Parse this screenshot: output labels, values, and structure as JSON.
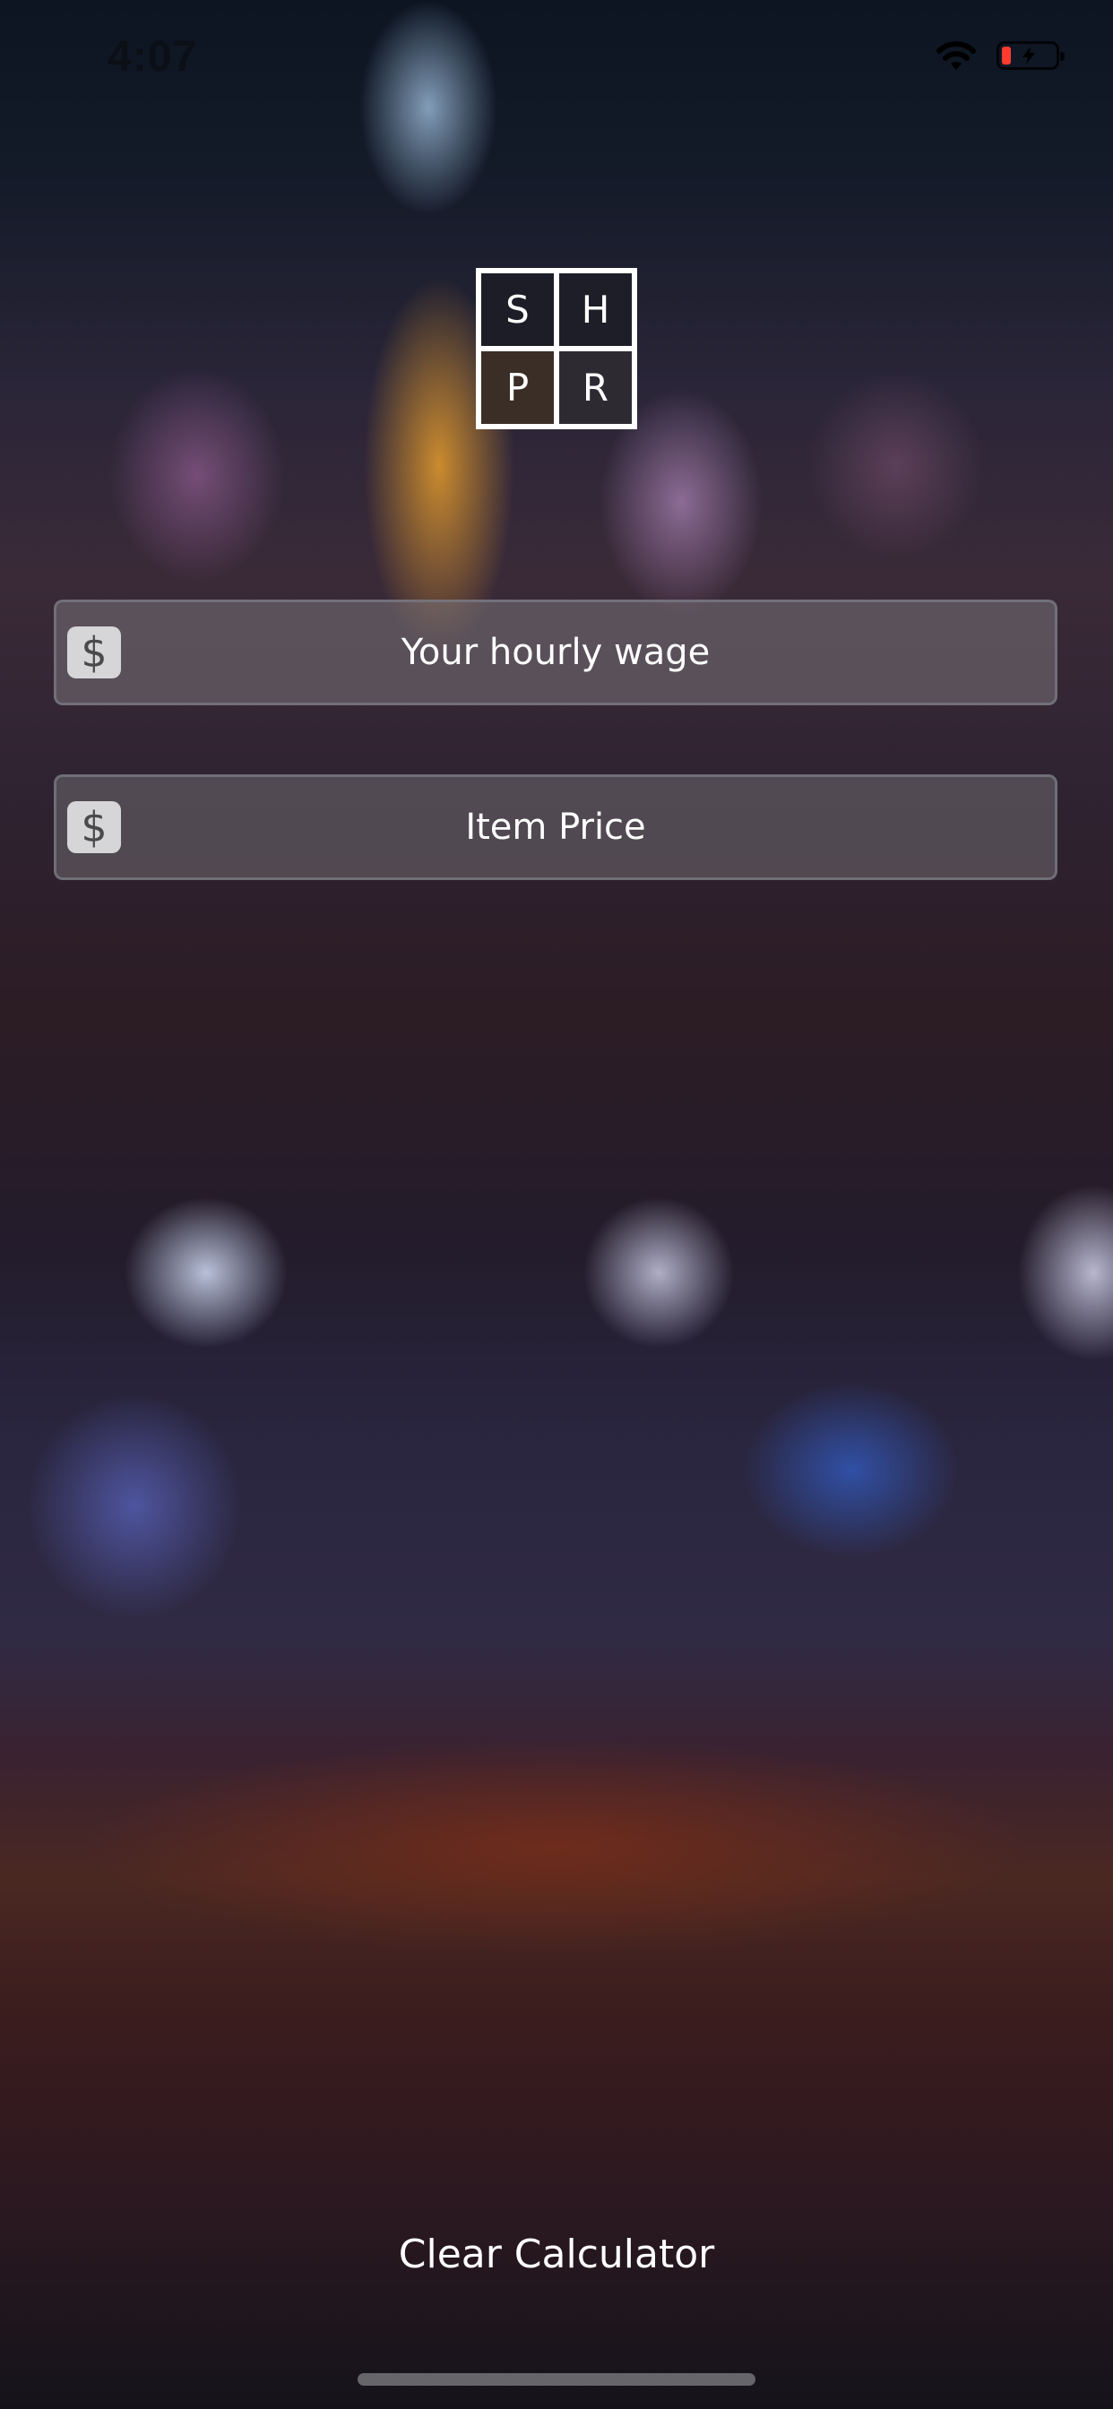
{
  "status_bar": {
    "time": "4:07",
    "battery_color": "#ff3b30",
    "icons": [
      "wifi-icon",
      "battery-charging-icon"
    ]
  },
  "logo": {
    "letters": [
      "S",
      "H",
      "P",
      "R"
    ]
  },
  "form": {
    "wage": {
      "icon": "dollar-sign-icon",
      "icon_text": "$",
      "placeholder": "Your hourly wage",
      "value": ""
    },
    "price": {
      "icon": "dollar-sign-icon",
      "icon_text": "$",
      "placeholder": "Item Price",
      "value": ""
    }
  },
  "actions": {
    "clear_label": "Clear Calculator"
  }
}
